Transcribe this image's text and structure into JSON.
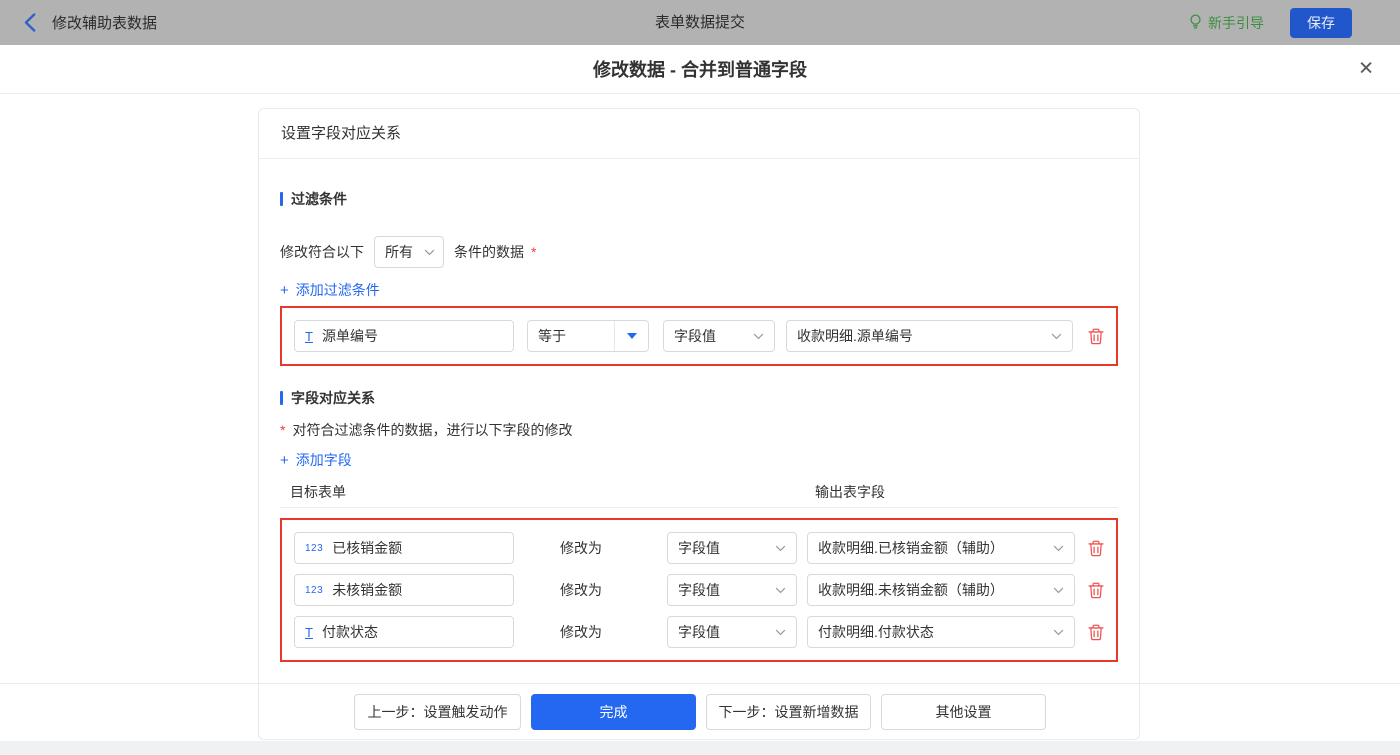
{
  "topbar": {
    "back_label": "修改辅助表数据",
    "title": "表单数据提交",
    "guide_label": "新手引导",
    "save_label": "保存"
  },
  "dialog": {
    "title": "修改数据 - 合并到普通字段",
    "close_glyph": "✕"
  },
  "panel": {
    "header": "设置字段对应关系"
  },
  "filter": {
    "section_title": "过滤条件",
    "match_prefix": "修改符合以下",
    "match_value": "所有",
    "match_suffix": "条件的数据",
    "required_mark": "*",
    "add_plus": "+",
    "add_label": "添加过滤条件",
    "row": {
      "field_icon": "T",
      "field_name": "源单编号",
      "operator": "等于",
      "value_type": "字段值",
      "value_field": "收款明细.源单编号"
    }
  },
  "mapping": {
    "section_title": "字段对应关系",
    "required_mark": "*",
    "description": "对符合过滤条件的数据，进行以下字段的修改",
    "add_plus": "+",
    "add_label": "添加字段",
    "columns": {
      "target": "目标表单",
      "output": "输出表字段"
    },
    "modify_label": "修改为",
    "rows": [
      {
        "field_icon": "123",
        "field_name": "已核销金额",
        "value_type": "字段值",
        "output_field": "收款明细.已核销金额（辅助）"
      },
      {
        "field_icon": "123",
        "field_name": "未核销金额",
        "value_type": "字段值",
        "output_field": "收款明细.未核销金额（辅助）"
      },
      {
        "field_icon": "T",
        "field_name": "付款状态",
        "value_type": "字段值",
        "output_field": "付款明细.付款状态"
      }
    ]
  },
  "footer": {
    "prev": "上一步：设置触发动作",
    "done": "完成",
    "next": "下一步：设置新增数据",
    "other": "其他设置"
  },
  "colors": {
    "accent_blue": "#2468f2",
    "highlight_red": "#e6392c",
    "trash_red": "#ef5350",
    "guide_green": "#3e8e41",
    "topbar_gray": "#b2b2b2"
  }
}
